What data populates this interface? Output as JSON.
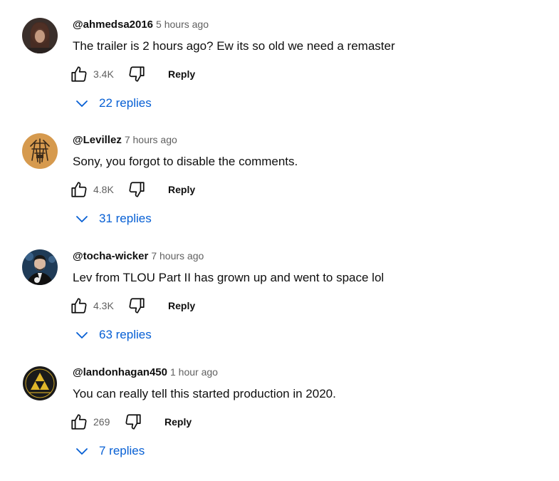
{
  "comments": [
    {
      "author": "@ahmedsa2016",
      "time": "5 hours ago",
      "text": "The trailer is 2 hours ago? Ew its so old we need a remaster",
      "likes": "3.4K",
      "reply_label": "Reply",
      "replies_label": "22 replies",
      "avatar": "avatar-portrait-dark-hair"
    },
    {
      "author": "@Levillez",
      "time": "7 hours ago",
      "text": "Sony, you forgot to disable the comments.",
      "likes": "4.8K",
      "reply_label": "Reply",
      "replies_label": "31 replies",
      "avatar": "avatar-orange-glyph"
    },
    {
      "author": "@tocha-wicker",
      "time": "7 hours ago",
      "text": "Lev from TLOU Part II has grown up and went to space lol",
      "likes": "4.3K",
      "reply_label": "Reply",
      "replies_label": "63 replies",
      "avatar": "avatar-man-in-suit"
    },
    {
      "author": "@landonhagan450",
      "time": "1 hour ago",
      "text": "You can really tell this started production in 2020.",
      "likes": "269",
      "reply_label": "Reply",
      "replies_label": "7 replies",
      "avatar": "avatar-triforce-emblem"
    }
  ],
  "colors": {
    "link_blue": "#065fd4",
    "text": "#0f0f0f",
    "muted": "#606060"
  }
}
